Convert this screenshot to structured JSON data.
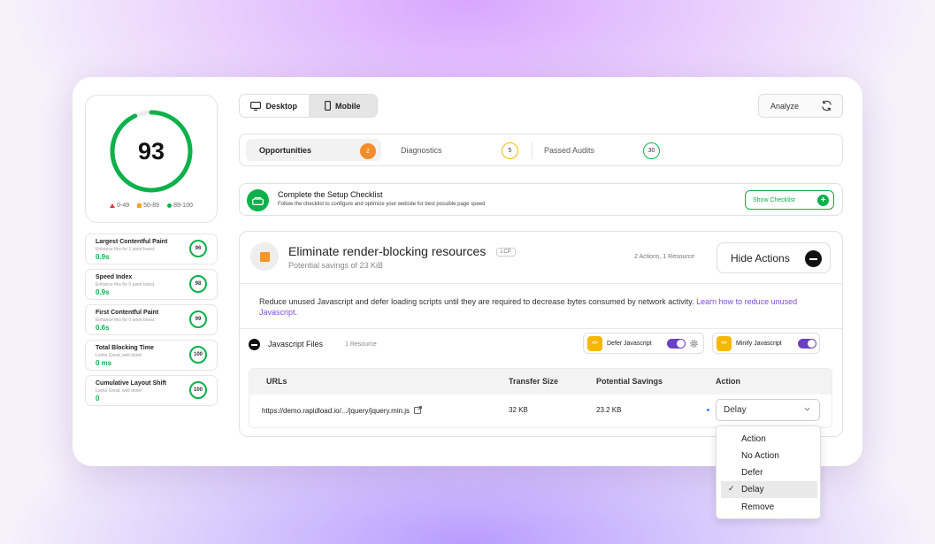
{
  "score": {
    "value": "93",
    "fraction": 0.93,
    "legend": [
      "0-49",
      "50-89",
      "89-100"
    ],
    "colors": {
      "fail": "#e53935",
      "average": "#f5a623",
      "pass": "#0cb14b"
    }
  },
  "metrics": [
    {
      "title": "Largest Contentful Paint",
      "sub": "Enhance this for 1 point boost.",
      "value": "0.9s",
      "score": "96"
    },
    {
      "title": "Speed Index",
      "sub": "Enhance this for 0 point boost.",
      "value": "0.9s",
      "score": "98"
    },
    {
      "title": "First Contentful Paint",
      "sub": "Enhance this for 0 point boost.",
      "value": "0.6s",
      "score": "99"
    },
    {
      "title": "Total Blocking Time",
      "sub": "Looks Great, well done!",
      "value": "0 ms",
      "score": "100"
    },
    {
      "title": "Cumulative Layout Shift",
      "sub": "Looks Great, well done!",
      "value": "0",
      "score": "100"
    }
  ],
  "device": {
    "desktop": "Desktop",
    "mobile": "Mobile"
  },
  "analyze": {
    "label": "Analyze",
    "icon": "refresh-icon"
  },
  "tabs": [
    {
      "label": "Opportunities",
      "count": "2"
    },
    {
      "label": "Diagnostics",
      "count": "5"
    },
    {
      "label": "Passed Audits",
      "count": "30"
    }
  ],
  "setup": {
    "title": "Complete the Setup Checklist",
    "subtitle": "Follow the checklist to configure and optimize your website for best possible page speed",
    "button": "Show Checklist"
  },
  "audit": {
    "title": "Eliminate render-blocking resources",
    "tag": "LCP",
    "savings": "Potential savings of 23 KiB",
    "meta": "2 Actions, 1 Resource",
    "hide_button": "Hide Actions",
    "description": "Reduce unused Javascript and defer loading scripts until they are required to decrease bytes consumed by network activity. ",
    "link": "Learn how to reduce unused Javascript.",
    "section_title": "Javascript Files",
    "section_count": "1 Resource",
    "options": [
      {
        "icon_text": "</>",
        "label": "Defer Javascript",
        "on": true
      },
      {
        "icon_text": "</>",
        "label": "Minify Javascript",
        "on": true
      }
    ],
    "table": {
      "headers": [
        "URLs",
        "Transfer Size",
        "Potential Savings",
        "Action"
      ],
      "rows": [
        {
          "url": "https://demo.rapidload.io/.../jquery/jquery.min.js",
          "transfer": "32 KB",
          "savings": "23.2 KB",
          "action": "Delay"
        }
      ]
    },
    "action_options": [
      "Action",
      "No Action",
      "Defer",
      "Delay",
      "Remove"
    ],
    "selected_option": "Delay"
  }
}
